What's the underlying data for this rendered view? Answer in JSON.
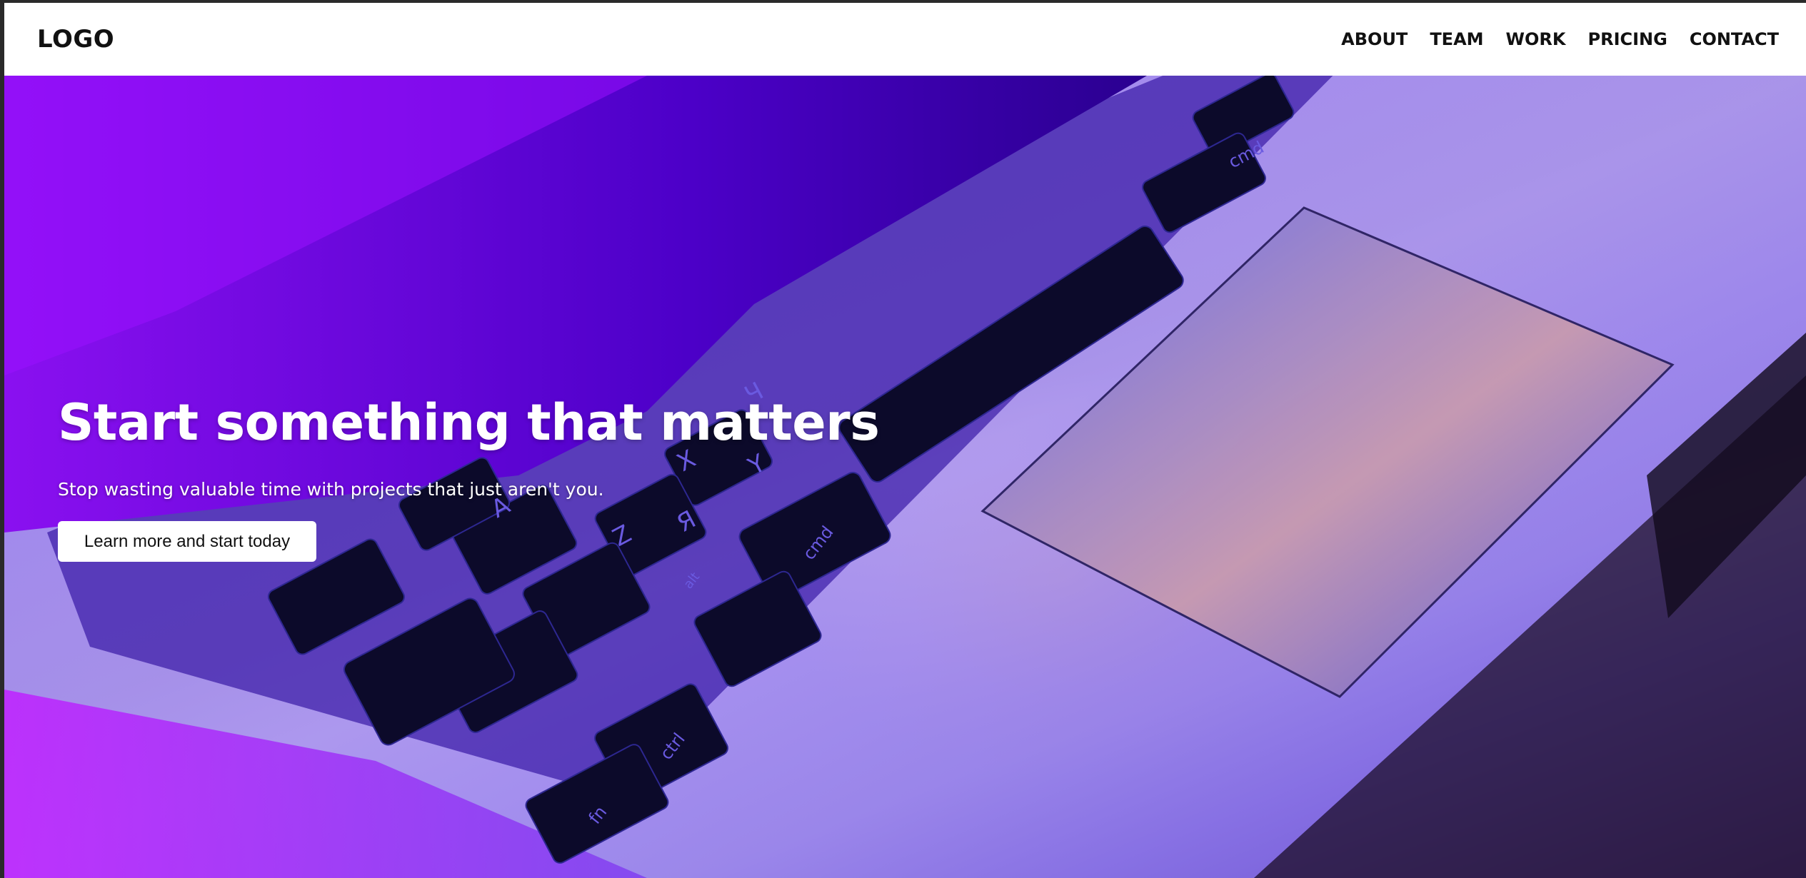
{
  "nav": {
    "logo": "LOGO",
    "links": [
      {
        "label": "ABOUT"
      },
      {
        "label": "TEAM"
      },
      {
        "label": "WORK"
      },
      {
        "label": "PRICING"
      },
      {
        "label": "CONTACT"
      }
    ]
  },
  "hero": {
    "title": "Start something that matters",
    "subtitle": "Stop wasting valuable time with projects that just aren't you.",
    "cta_label": "Learn more and start today",
    "image": "laptop-keyboard-photo",
    "keys": [
      "cmd",
      "cmd",
      "ctrl",
      "alt",
      "fn",
      "X",
      "Z",
      "A",
      "Y",
      "Я",
      "Ч"
    ]
  },
  "colors": {
    "nav_bg": "#ffffff",
    "text_dark": "#111111",
    "hero_purple": "#7d0ae6",
    "hero_blue": "#2a0088",
    "cta_bg": "#ffffff"
  }
}
